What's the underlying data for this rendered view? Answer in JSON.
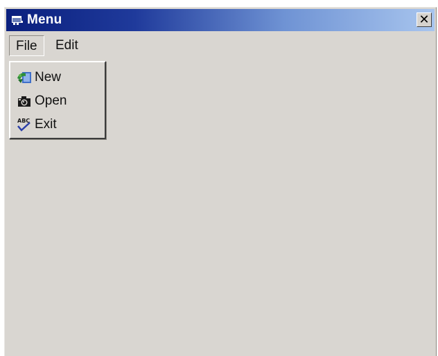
{
  "window": {
    "title": "Menu",
    "close_label": "✕"
  },
  "menubar": {
    "items": [
      {
        "label": "File",
        "active": true
      },
      {
        "label": "Edit",
        "active": false
      }
    ]
  },
  "file_menu": {
    "items": [
      {
        "label": "New",
        "icon": "new-document-icon"
      },
      {
        "label": "Open",
        "icon": "open-camera-icon"
      },
      {
        "label": "Exit",
        "icon": "spellcheck-abc-icon"
      }
    ]
  },
  "colors": {
    "titlebar_start": "#0a1f7d",
    "titlebar_end": "#a8c5ee",
    "window_bg": "#d9d6d1"
  }
}
